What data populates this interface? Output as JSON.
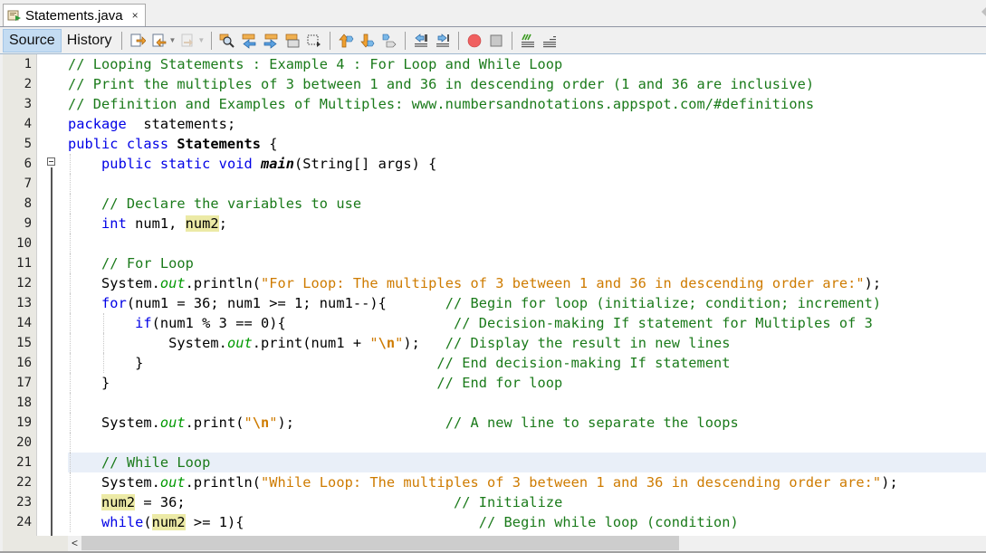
{
  "tab": {
    "title": "Statements.java",
    "close": "×",
    "file_icon": "java-file-icon"
  },
  "toolbar": {
    "source_label": "Source",
    "history_label": "History",
    "icons": [
      "last-edit-icon",
      "back-icon",
      "forward-icon",
      "find-selection-icon",
      "find-previous-icon",
      "find-next-icon",
      "toggle-highlight-icon",
      "toggle-rectangular-selection-icon",
      "previous-bookmark-icon",
      "next-bookmark-icon",
      "toggle-bookmark-icon",
      "shift-left-icon",
      "shift-right-icon",
      "start-macro-recording-icon",
      "stop-macro-recording-icon",
      "comment-icon",
      "uncomment-icon"
    ]
  },
  "colors": {
    "keyword": "#0000e6",
    "comment": "#1a7a1a",
    "string": "#ce7b00",
    "field": "#009900",
    "highlight": "#eceaa6",
    "current_line": "#e9eff8",
    "active_tab": "#c4dcf2"
  },
  "editor": {
    "current_line": 21,
    "lines": [
      {
        "n": "1",
        "t": [
          [
            "cm",
            "// Looping Statements : Example 4 : For Loop and While Loop"
          ]
        ]
      },
      {
        "n": "2",
        "t": [
          [
            "cm",
            "// Print the multiples of 3 between 1 and 36 in descending order (1 and 36 are inclusive)"
          ]
        ]
      },
      {
        "n": "3",
        "t": [
          [
            "cm",
            "// Definition and Examples of Multiples: www.numbersandnotations.appspot.com/#definitions"
          ]
        ]
      },
      {
        "n": "4",
        "t": [
          [
            "kw",
            "package"
          ],
          [
            "",
            "  statements;"
          ]
        ]
      },
      {
        "n": "5",
        "t": [
          [
            "kw",
            "public class "
          ],
          [
            "bold",
            "Statements"
          ],
          [
            "",
            " {"
          ]
        ]
      },
      {
        "n": "6",
        "t": [
          [
            "",
            "    "
          ],
          [
            "kw",
            "public static void "
          ],
          [
            "bi",
            "main"
          ],
          [
            "",
            "(String[] args) {"
          ]
        ]
      },
      {
        "n": "7",
        "t": []
      },
      {
        "n": "8",
        "t": [
          [
            "",
            "    "
          ],
          [
            "cm",
            "// Declare the variables to use"
          ]
        ]
      },
      {
        "n": "9",
        "t": [
          [
            "",
            "    "
          ],
          [
            "kw",
            "int"
          ],
          [
            "",
            " num1, "
          ],
          [
            "hl",
            "num2"
          ],
          [
            "",
            ";"
          ]
        ]
      },
      {
        "n": "10",
        "t": []
      },
      {
        "n": "11",
        "t": [
          [
            "",
            "    "
          ],
          [
            "cm",
            "// For Loop"
          ]
        ]
      },
      {
        "n": "12",
        "t": [
          [
            "",
            "    System."
          ],
          [
            "fld",
            "out"
          ],
          [
            "",
            ".println("
          ],
          [
            "str",
            "\"For Loop: The multiples of 3 between 1 and 36 in descending order are:\""
          ],
          [
            "",
            ");"
          ]
        ]
      },
      {
        "n": "13",
        "t": [
          [
            "",
            "    "
          ],
          [
            "kw",
            "for"
          ],
          [
            "",
            "(num1 = 36; num1 >= 1; num1--){       "
          ],
          [
            "cm",
            "// Begin for loop (initialize; condition; increment)"
          ]
        ]
      },
      {
        "n": "14",
        "t": [
          [
            "",
            "        "
          ],
          [
            "kw",
            "if"
          ],
          [
            "",
            "(num1 % 3 == 0){                    "
          ],
          [
            "cm",
            "// Decision-making If statement for Multiples of 3"
          ]
        ]
      },
      {
        "n": "15",
        "t": [
          [
            "",
            "            System."
          ],
          [
            "fld",
            "out"
          ],
          [
            "",
            ".print(num1 + "
          ],
          [
            "str",
            "\""
          ],
          [
            "esc",
            "\\n"
          ],
          [
            "str",
            "\""
          ],
          [
            "",
            ");   "
          ],
          [
            "cm",
            "// Display the result in new lines"
          ]
        ]
      },
      {
        "n": "16",
        "t": [
          [
            "",
            "        }                                   "
          ],
          [
            "cm",
            "// End decision-making If statement"
          ]
        ]
      },
      {
        "n": "17",
        "t": [
          [
            "",
            "    }                                       "
          ],
          [
            "cm",
            "// End for loop"
          ]
        ]
      },
      {
        "n": "18",
        "t": []
      },
      {
        "n": "19",
        "t": [
          [
            "",
            "    System."
          ],
          [
            "fld",
            "out"
          ],
          [
            "",
            ".print("
          ],
          [
            "str",
            "\""
          ],
          [
            "esc",
            "\\n"
          ],
          [
            "str",
            "\""
          ],
          [
            "",
            ");                  "
          ],
          [
            "cm",
            "// A new line to separate the loops"
          ]
        ]
      },
      {
        "n": "20",
        "t": []
      },
      {
        "n": "21",
        "t": [
          [
            "",
            "    "
          ],
          [
            "cm",
            "// While Loop"
          ]
        ]
      },
      {
        "n": "22",
        "t": [
          [
            "",
            "    System."
          ],
          [
            "fld",
            "out"
          ],
          [
            "",
            ".println("
          ],
          [
            "str",
            "\"While Loop: The multiples of 3 between 1 and 36 in descending order are:\""
          ],
          [
            "",
            ");"
          ]
        ]
      },
      {
        "n": "23",
        "t": [
          [
            "",
            "    "
          ],
          [
            "hl",
            "num2"
          ],
          [
            "",
            " = 36;                                "
          ],
          [
            "cm",
            "// Initialize"
          ]
        ]
      },
      {
        "n": "24",
        "t": [
          [
            "",
            "    "
          ],
          [
            "kw",
            "while"
          ],
          [
            "",
            "("
          ],
          [
            "hl",
            "num2"
          ],
          [
            "",
            " >= 1){                            "
          ],
          [
            "cm",
            "// Begin while loop (condition)"
          ]
        ]
      }
    ]
  },
  "scrollbar": {
    "horizontal_position": 0
  }
}
